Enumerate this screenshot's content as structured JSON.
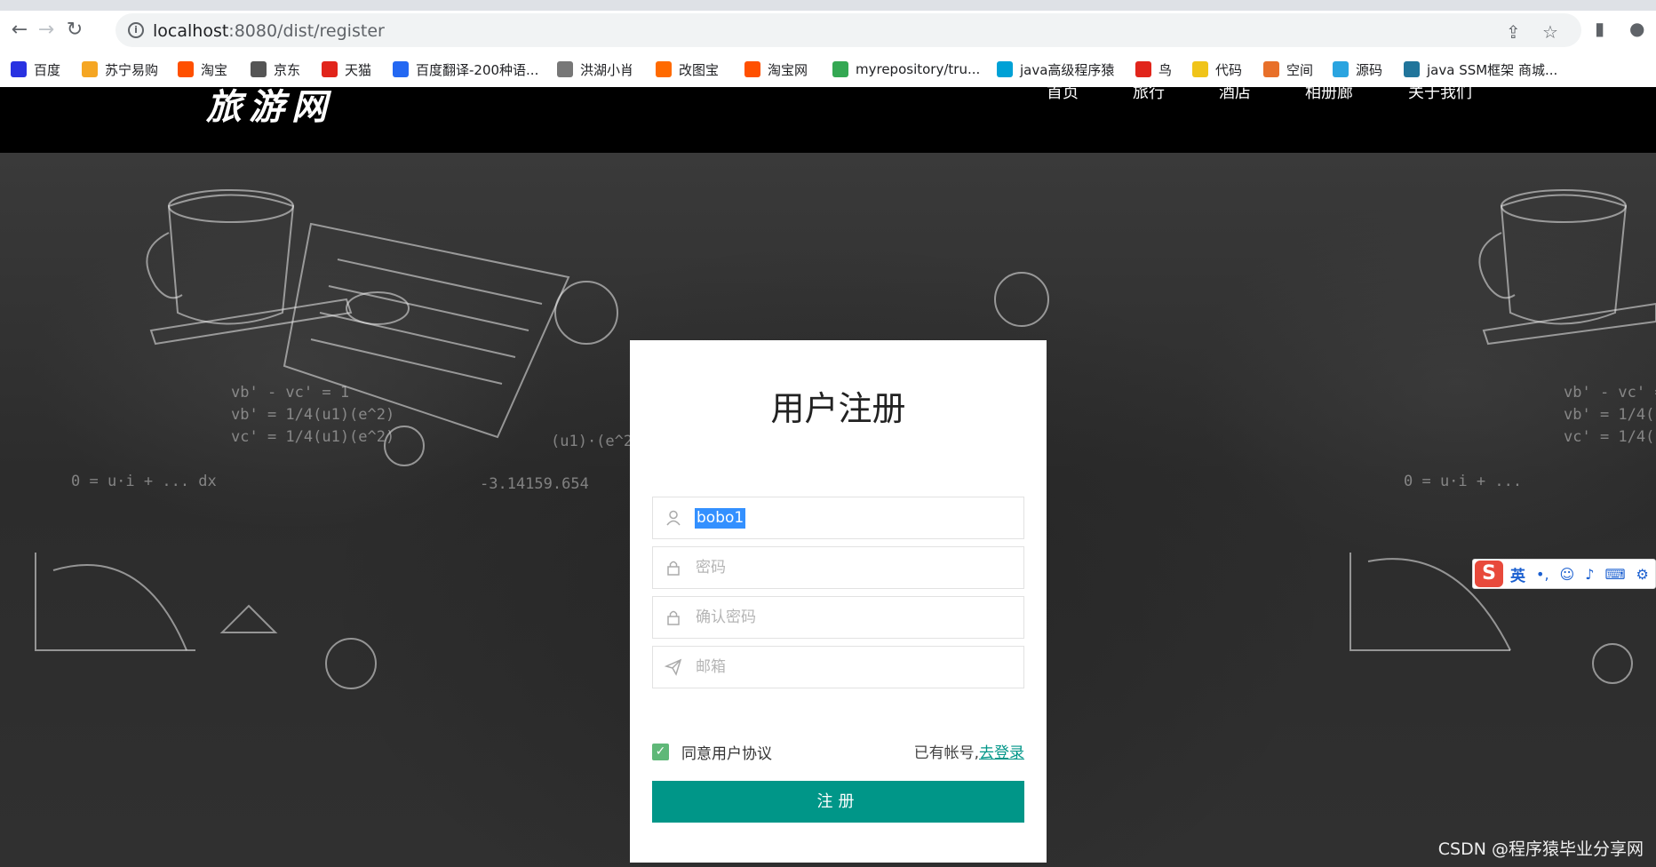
{
  "browser": {
    "url_host": "localhost",
    "url_rest": ":8080/dist/register",
    "back_icon": "arrow-left-icon",
    "forward_icon": "arrow-right-icon",
    "reload_icon": "reload-icon"
  },
  "bookmarks": [
    {
      "label": "百度",
      "icon": "paw-icon",
      "color": "#2932e1"
    },
    {
      "label": "苏宁易购",
      "icon": "smile-icon",
      "color": "#f5a623"
    },
    {
      "label": "淘宝",
      "icon": "taobao-icon",
      "color": "#ff5000"
    },
    {
      "label": "京东",
      "icon": "globe-icon",
      "color": "#555555"
    },
    {
      "label": "天猫",
      "icon": "tmall-icon",
      "color": "#e1251b"
    },
    {
      "label": "百度翻译-200种语...",
      "icon": "translate-icon",
      "color": "#2468f2"
    },
    {
      "label": "洪湖小肖",
      "icon": "feather-icon",
      "color": "#777777"
    },
    {
      "label": "改图宝",
      "icon": "image-icon",
      "color": "#ff6a00"
    },
    {
      "label": "淘宝网",
      "icon": "taobao-icon",
      "color": "#ff5000"
    },
    {
      "label": "myrepository/tru...",
      "icon": "chrome-icon",
      "color": "#34a853"
    },
    {
      "label": "java高级程序猿",
      "icon": "tv-icon",
      "color": "#00a1d6"
    },
    {
      "label": "鸟",
      "icon": "bird-icon",
      "color": "#e1251b"
    },
    {
      "label": "代码",
      "icon": "leaf-icon",
      "color": "#f0c419"
    },
    {
      "label": "空间",
      "icon": "star-icon",
      "color": "#e8702a"
    },
    {
      "label": "源码",
      "icon": "fish-icon",
      "color": "#2aa4e0"
    },
    {
      "label": "java SSM框架 商城...",
      "icon": "wordpress-icon",
      "color": "#21759b"
    }
  ],
  "site": {
    "logo": "旅游网",
    "nav": [
      "首页",
      "旅行",
      "酒店",
      "相册廊",
      "关于我们"
    ]
  },
  "register": {
    "title": "用户注册",
    "username_value": "bobo1",
    "password_placeholder": "密码",
    "confirm_placeholder": "确认密码",
    "email_placeholder": "邮箱",
    "agree_label": "同意用户协议",
    "agree_checked": true,
    "have_account": "已有帐号,",
    "login_link": "去登录",
    "submit_label": "注册"
  },
  "ime": {
    "logo": "S",
    "mode": "英"
  },
  "watermark": "CSDN @程序猿毕业分享网",
  "colors": {
    "accent": "#009688",
    "checkbox": "#5fb878",
    "header": "#000000"
  }
}
